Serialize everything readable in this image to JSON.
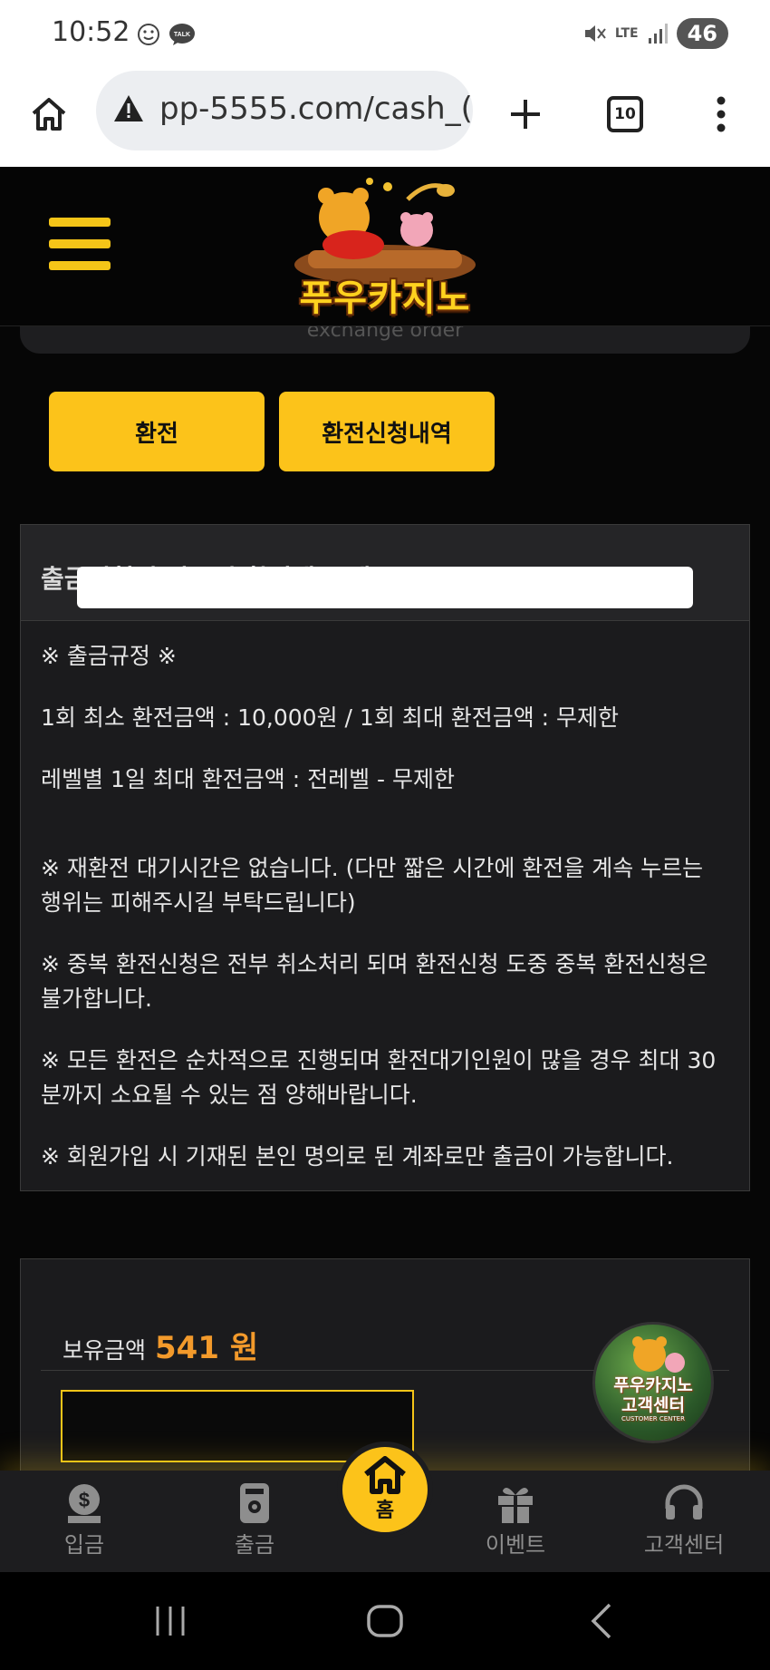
{
  "status_bar": {
    "time": "10:52",
    "network": "LTE",
    "battery": "46"
  },
  "browser": {
    "url": "pp-5555.com/cash_(",
    "tab_count": "10"
  },
  "site": {
    "logo_text": "푸우카지노"
  },
  "previous_panel": {
    "subtitle": "exchange order"
  },
  "tabs": [
    {
      "label": "환전"
    },
    {
      "label": "환전신청내역"
    }
  ],
  "rules": {
    "title": "출금신청전 반드시 확인해 주세요",
    "heading": "※ 출금규정 ※",
    "line_min_max": "1회 최소 환전금액 : 10,000원 / 1회 최대 환전금액 : 무제한",
    "line_daily": "레벨별 1일 최대 환전금액 : 전레벨 - 무제한",
    "note_wait": "※ 재환전 대기시간은 없습니다. (다만 짧은 시간에 환전을 계속 누르는 행위는 피해주시길 부탁드립니다)",
    "note_duplicate": "※ 중복 환전신청은 전부 취소처리 되며 환전신청 도중 중복 환전신청은 불가합니다.",
    "note_order": "※ 모든 환전은 순차적으로 진행되며 환전대기인원이 많을 경우 최대 30분까지 소요될 수 있는 점 양해바랍니다.",
    "note_account": "※ 회원가입 시 기재된 본인 명의로 된 계좌로만 출금이 가능합니다."
  },
  "balance": {
    "label": "보유금액",
    "value": "541 원"
  },
  "customer_center_badge": {
    "brand": "푸우카지노",
    "title": "고객센터",
    "subtitle": "CUSTOMER CENTER"
  },
  "bottom_nav": {
    "deposit": "입금",
    "withdraw": "출금",
    "home": "홈",
    "event": "이벤트",
    "support": "고객센터"
  },
  "colors": {
    "accent": "#fcc31a",
    "balance_value": "#f39a2b",
    "panel": "#1b1b1d"
  }
}
